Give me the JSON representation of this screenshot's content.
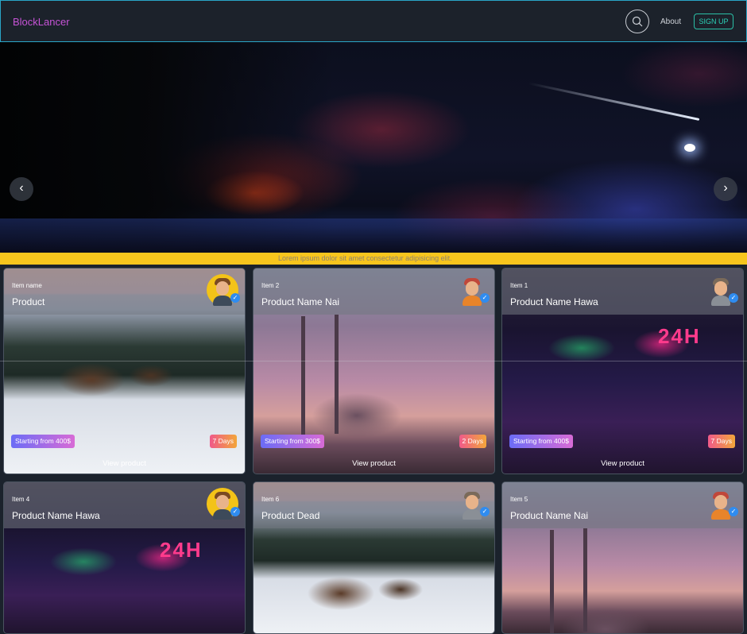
{
  "nav": {
    "brand": "BlockLancer",
    "about": "About",
    "signup": "SIGN UP"
  },
  "hero": {
    "prev": "‹",
    "next": "›"
  },
  "marquee": {
    "text": "Lorem ipsum dolor sit amet consectetur adipisicing elit."
  },
  "cards": [
    {
      "item": "Item name",
      "product": "Product",
      "price": "Starting from 400$",
      "days": "7 Days",
      "view": "View product"
    },
    {
      "item": "Item 2",
      "product": "Product Name Nai",
      "price": "Starting from 300$",
      "days": "2 Days",
      "view": "View product"
    },
    {
      "item": "Item 1",
      "product": "Product Name Hawa",
      "price": "Starting from 400$",
      "days": "7 Days",
      "view": "View product"
    },
    {
      "item": "Item 4",
      "product": "Product Name Hawa"
    },
    {
      "item": "Item 6",
      "product": "Product Dead"
    },
    {
      "item": "Item 5",
      "product": "Product Name Nai"
    }
  ],
  "neon_sign": "24H",
  "colors": {
    "brand": "#c653d6",
    "accent": "#2bd3b8",
    "marquee": "#f7c51d"
  },
  "icons": {
    "search": "search-icon",
    "verified": "verified-icon"
  }
}
